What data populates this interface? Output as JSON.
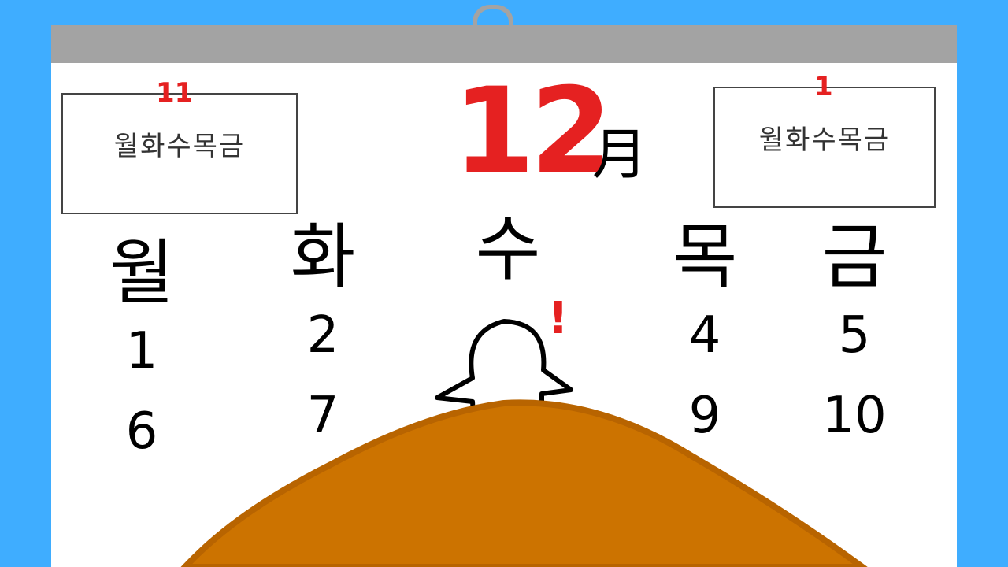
{
  "calendar": {
    "month": "12",
    "month_suffix": "月",
    "prev_month": {
      "month": "11",
      "weekdays": "월화수목금"
    },
    "next_month": {
      "month": "1",
      "weekdays": "월화수목금"
    },
    "columns": [
      {
        "day": "월",
        "numbers": [
          "1",
          "6"
        ]
      },
      {
        "day": "화",
        "numbers": [
          "2",
          "7"
        ]
      },
      {
        "day": "수",
        "numbers": []
      },
      {
        "day": "목",
        "numbers": [
          "4",
          "9"
        ]
      },
      {
        "day": "금",
        "numbers": [
          "5",
          "10"
        ]
      }
    ],
    "exclamation": "!"
  },
  "colors": {
    "background": "#3fadff",
    "accent": "#e52121",
    "mound": "#cc7300",
    "bar": "#a3a3a3"
  }
}
